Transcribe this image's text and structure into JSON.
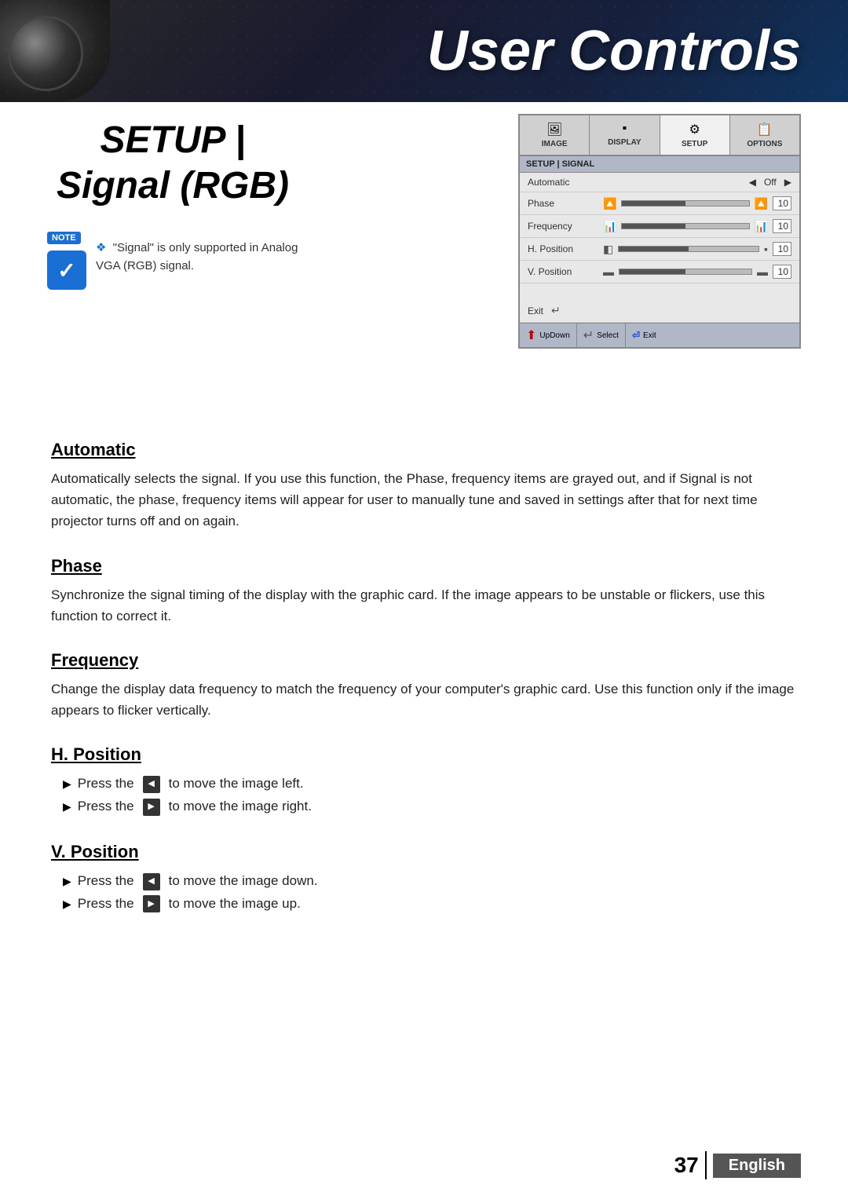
{
  "header": {
    "title": "User Controls"
  },
  "page_subtitle": "SETUP | Signal (RGB)",
  "note": {
    "badge": "NOTE",
    "text": "\"Signal\" is only supported in Analog VGA (RGB) signal."
  },
  "osd": {
    "tabs": [
      {
        "icon": "🖼",
        "label": "IMAGE"
      },
      {
        "icon": "▪",
        "label": "DISPLAY"
      },
      {
        "icon": "⚙",
        "label": "SETUP"
      },
      {
        "icon": "📋",
        "label": "OPTIONS"
      }
    ],
    "breadcrumb": "SETUP | SIGNAL",
    "rows": [
      {
        "label": "Automatic",
        "type": "arrow",
        "value": "Off"
      },
      {
        "label": "Phase",
        "type": "bar",
        "value": "10"
      },
      {
        "label": "Frequency",
        "type": "bar",
        "value": "10"
      },
      {
        "label": "H. Position",
        "type": "bar",
        "value": "10"
      },
      {
        "label": "V. Position",
        "type": "bar",
        "value": "10"
      }
    ],
    "exit_label": "Exit",
    "footer": [
      {
        "icon": "▲▼",
        "label": "UpDown",
        "color": "red"
      },
      {
        "icon": "↵",
        "label": "Select",
        "color": "gray"
      },
      {
        "icon": "⏎",
        "label": "Exit",
        "color": "blue"
      }
    ]
  },
  "sections": [
    {
      "id": "automatic",
      "heading": "Automatic",
      "text": "Automatically selects the signal. If you use this function, the Phase, frequency items are grayed out, and if Signal is not automatic, the phase, frequency items will appear for user to manually tune and saved in settings after that for next time projector turns off and on again.",
      "bullets": []
    },
    {
      "id": "phase",
      "heading": "Phase",
      "text": "Synchronize the signal timing of the display with the graphic card. If the image appears to be unstable or flickers, use this function to correct it.",
      "bullets": []
    },
    {
      "id": "frequency",
      "heading": "Frequency",
      "text": "Change the display data frequency to match the frequency of your computer's graphic card. Use this function only if the image appears to flicker vertically.",
      "bullets": []
    },
    {
      "id": "h-position",
      "heading": "H. Position",
      "text": "",
      "bullets": [
        {
          "text_before": "Press the",
          "direction": "◀",
          "text_after": "to move the image left."
        },
        {
          "text_before": "Press the",
          "direction": "▶",
          "text_after": "to move the image right."
        }
      ]
    },
    {
      "id": "v-position",
      "heading": "V. Position",
      "text": "",
      "bullets": [
        {
          "text_before": "Press the",
          "direction": "◀",
          "text_after": "to move the image down."
        },
        {
          "text_before": "Press the",
          "direction": "▶",
          "text_after": "to move the image up."
        }
      ]
    }
  ],
  "footer": {
    "page_number": "37",
    "language": "English"
  }
}
